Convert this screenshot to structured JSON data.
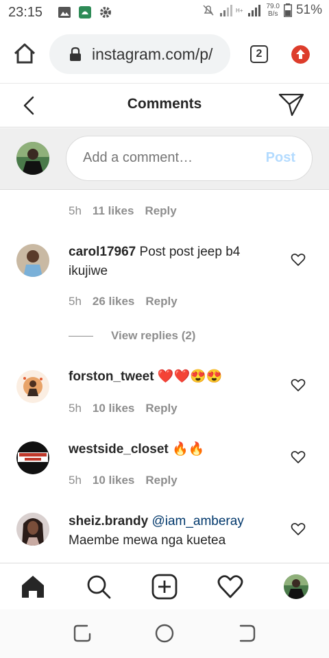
{
  "status_bar": {
    "time": "23:15",
    "net_speed_value": "79.0",
    "net_speed_unit": "B/s",
    "battery": "51%",
    "network_label": "H+"
  },
  "browser": {
    "url": "instagram.com/p/",
    "tab_count": "2"
  },
  "header": {
    "title": "Comments"
  },
  "add_comment": {
    "placeholder": "Add a comment…",
    "post_label": "Post"
  },
  "top_meta": {
    "time": "5h",
    "likes": "11 likes",
    "reply": "Reply"
  },
  "comments": [
    {
      "username": "carol17967",
      "text": "Post post jeep b4 ikujiwe",
      "time": "5h",
      "likes": "26 likes",
      "reply": "Reply",
      "view_replies": "View replies (2)"
    },
    {
      "username": "forston_tweet",
      "text": "❤️❤️😍😍",
      "time": "5h",
      "likes": "10 likes",
      "reply": "Reply"
    },
    {
      "username": "westside_closet",
      "text": "🔥🔥",
      "time": "5h",
      "likes": "10 likes",
      "reply": "Reply"
    },
    {
      "username": "sheiz.brandy",
      "mention": "@iam_amberay",
      "text": "Maembe mewa nga kuetea"
    }
  ],
  "colors": {
    "post_disabled": "#b3dbff",
    "mention": "#00376b",
    "meta_gray": "#8e8e8e",
    "update_red": "#dd3c2b"
  }
}
